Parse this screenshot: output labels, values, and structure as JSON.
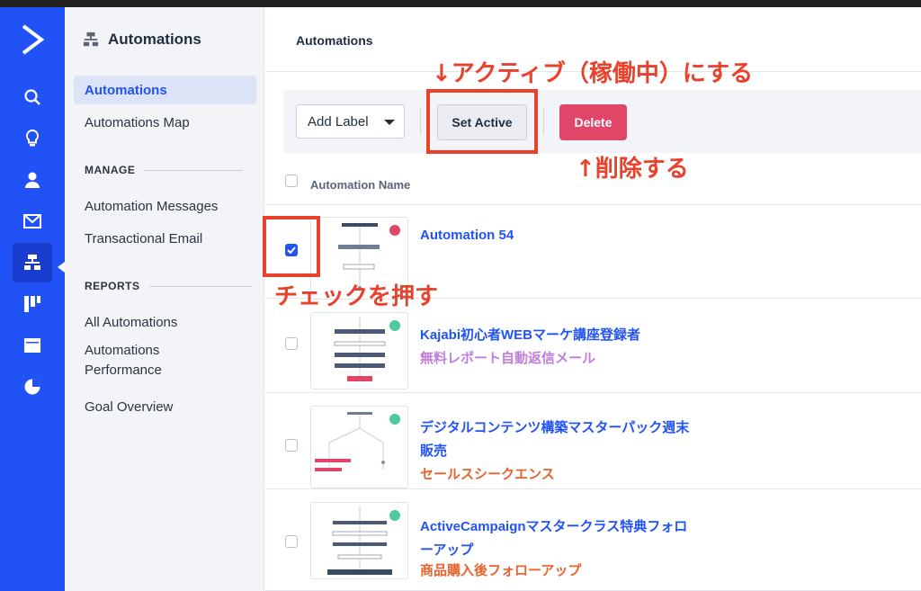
{
  "rail": {
    "icons": [
      "search-icon",
      "lightbulb-icon",
      "contacts-icon",
      "email-icon",
      "automations-icon",
      "pipeline-icon",
      "site-icon",
      "reports-icon"
    ],
    "accent": "#2152f5"
  },
  "sidebar": {
    "title": "Automations",
    "items": [
      {
        "label": "Automations",
        "active": true
      },
      {
        "label": "Automations Map"
      }
    ],
    "manage_heading": "MANAGE",
    "manage_items": [
      {
        "label": "Automation Messages"
      },
      {
        "label": "Transactional Email"
      }
    ],
    "reports_heading": "REPORTS",
    "report_items": [
      {
        "label": "All Automations"
      },
      {
        "label": "Automations\nPerformance"
      },
      {
        "label": "Goal Overview"
      }
    ]
  },
  "main": {
    "page_title": "Automations",
    "toolbar": {
      "add_label": "Add Label",
      "set_active": "Set Active",
      "delete": "Delete"
    },
    "column_header": "Automation Name",
    "rows": [
      {
        "name": "Automation 54",
        "label": "",
        "checked": true,
        "status_color": "#e2456a"
      },
      {
        "name": "Kajabi初心者WEBマーケ講座登録者",
        "label": "無料レポート自動返信メール",
        "label_color": "#c07fd8",
        "checked": false,
        "status_color": "#4ccc9a"
      },
      {
        "name": "デジタルコンテンツ構築マスターパック週末\n販売",
        "label": "セールスシークエンス",
        "label_color": "#e8632c",
        "checked": false,
        "status_color": "#4ccc9a"
      },
      {
        "name": "ActiveCampaignマスタークラス特典フォロ\nーアップ",
        "label": "商品購入後フォローアップ",
        "label_color": "#e8632c",
        "checked": false,
        "status_color": "#4ccc9a"
      }
    ]
  },
  "annotations": {
    "set_active_note": "↓アクティブ（稼働中）にする",
    "delete_note": "↑削除する",
    "check_note": "チェックを押す",
    "color": "#e8412c"
  }
}
